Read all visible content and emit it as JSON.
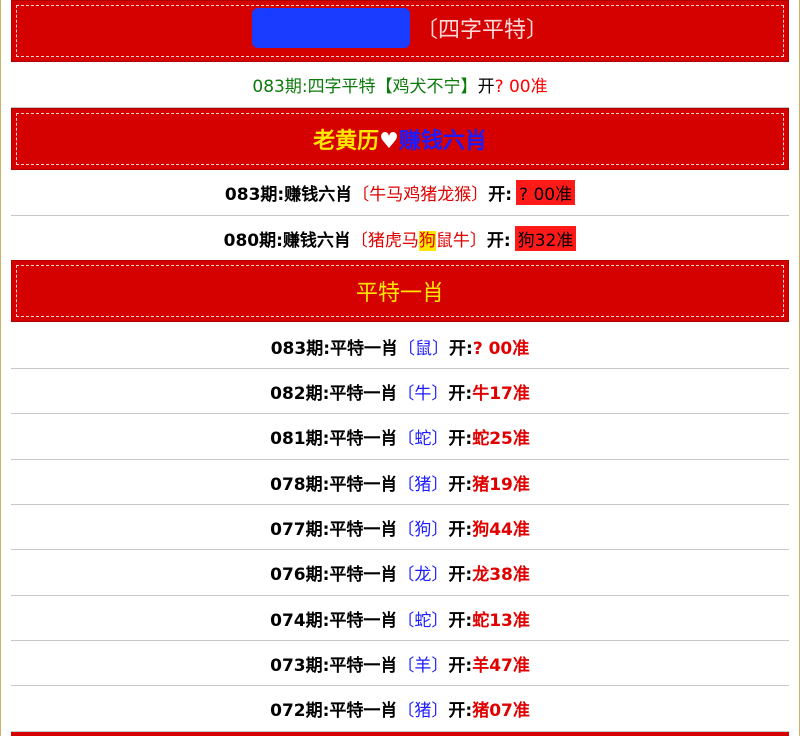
{
  "header": {
    "redacted_icon": "blue-redaction-blob",
    "title": "〔四字平特〕"
  },
  "four_char": {
    "period": "083期:",
    "name": "四字平特",
    "pick": "【鸡犬不宁】",
    "open_label": "开",
    "result": "? 00准"
  },
  "section2": {
    "part1": "老黄历",
    "heart": "♥",
    "part2": "赚钱六肖"
  },
  "six_rows": [
    {
      "period": "083期:",
      "name": "赚钱六肖",
      "pick": "〔牛马鸡猪龙猴〕",
      "open_label": "开:",
      "result": "? 00准"
    },
    {
      "period": "080期:",
      "name": "赚钱六肖",
      "pick_before": "〔猪虎马",
      "pick_hl": "狗",
      "pick_after": "鼠牛〕",
      "open_label": "开:",
      "result": "狗32准"
    }
  ],
  "section3": {
    "title": "平特一肖"
  },
  "list_rows": [
    {
      "period": "083期:",
      "name": "平特一肖",
      "pick": "〔鼠〕",
      "open_label": "开:",
      "result": "? 00准"
    },
    {
      "period": "082期:",
      "name": "平特一肖",
      "pick": "〔牛〕",
      "open_label": "开:",
      "result": "牛17准"
    },
    {
      "period": "081期:",
      "name": "平特一肖",
      "pick": "〔蛇〕",
      "open_label": "开:",
      "result": "蛇25准"
    },
    {
      "period": "078期:",
      "name": "平特一肖",
      "pick": "〔猪〕",
      "open_label": "开:",
      "result": "猪19准"
    },
    {
      "period": "077期:",
      "name": "平特一肖",
      "pick": "〔狗〕",
      "open_label": "开:",
      "result": "狗44准"
    },
    {
      "period": "076期:",
      "name": "平特一肖",
      "pick": "〔龙〕",
      "open_label": "开:",
      "result": "龙38准"
    },
    {
      "period": "074期:",
      "name": "平特一肖",
      "pick": "〔蛇〕",
      "open_label": "开:",
      "result": "蛇13准"
    },
    {
      "period": "073期:",
      "name": "平特一肖",
      "pick": "〔羊〕",
      "open_label": "开:",
      "result": "羊47准"
    },
    {
      "period": "072期:",
      "name": "平特一肖",
      "pick": "〔猪〕",
      "open_label": "开:",
      "result": "猪07准"
    }
  ],
  "colors": {
    "banner_red": "#d50000",
    "banner_text_yellow": "#ffe600",
    "pick_red": "#e00000",
    "pick_blue": "#1c1cff",
    "green_text": "#0b7a0b"
  }
}
